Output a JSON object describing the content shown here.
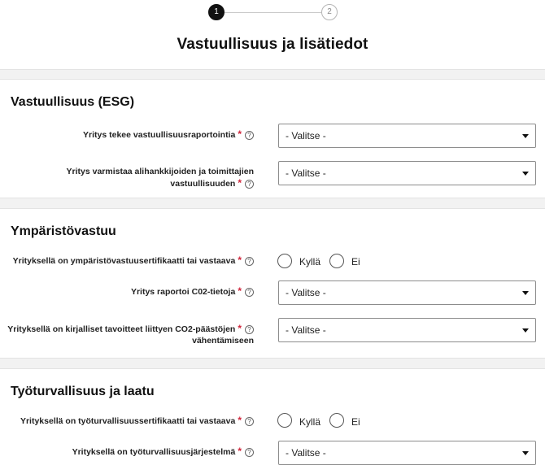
{
  "stepper": {
    "step1": "1",
    "step2": "2",
    "current": 1
  },
  "page_title": "Vastuullisuus ja lisätiedot",
  "sections": {
    "esg": {
      "title": "Vastuullisuus (ESG)",
      "rows": [
        {
          "label": "Yritys tekee vastuullisuusraportointia",
          "required": "*",
          "help": "?",
          "value": "- Valitse -"
        },
        {
          "label": "Yritys varmistaa alihankkijoiden ja toimittajien vastuullisuuden",
          "required": "*",
          "help": "?",
          "value": "- Valitse -"
        }
      ]
    },
    "environment": {
      "title": "Ympäristövastuu",
      "rows": [
        {
          "label": "Yrityksellä on ympäristövastuusertifikaatti tai vastaava",
          "required": "*",
          "help": "?",
          "yes": "Kyllä",
          "no": "Ei"
        },
        {
          "label": "Yritys raportoi C02-tietoja",
          "required": "*",
          "help": "?",
          "value": "- Valitse -"
        },
        {
          "label_line1": "Yrityksellä on kirjalliset tavoitteet liittyen CO2-päästöjen",
          "label_line2": "vähentämiseen",
          "required": "*",
          "help": "?",
          "value": "- Valitse -"
        }
      ]
    },
    "safety": {
      "title": "Työturvallisuus ja laatu",
      "rows": [
        {
          "label": "Yrityksellä on työturvallisuussertifikaatti tai vastaava",
          "required": "*",
          "help": "?",
          "yes": "Kyllä",
          "no": "Ei"
        },
        {
          "label": "Yrityksellä on työturvallisuusjärjestelmä",
          "required": "*",
          "help": "?",
          "value": "- Valitse -"
        }
      ]
    }
  },
  "colors": {
    "required": "#d0253b",
    "band": "#f2f2f2",
    "step_active": "#111111"
  }
}
